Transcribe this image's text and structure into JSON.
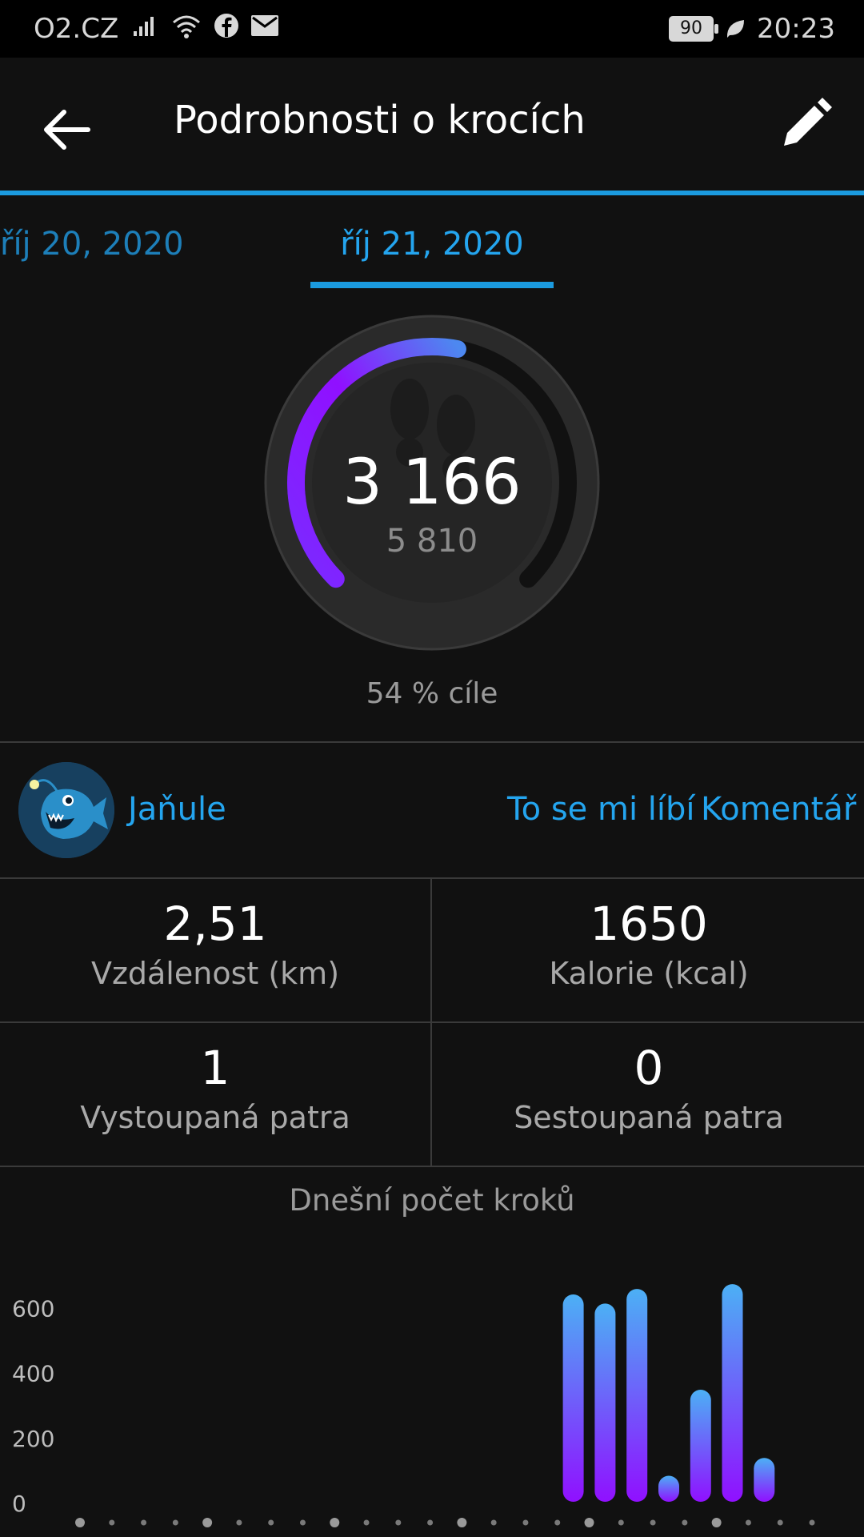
{
  "status_bar": {
    "carrier": "O2.CZ",
    "battery": "90",
    "time": "20:23"
  },
  "header": {
    "title": "Podrobnosti o krocích"
  },
  "date_tabs": {
    "previous": "říj 20, 2020",
    "current": "říj 21, 2020"
  },
  "summary": {
    "steps": "3 166",
    "goal": "5 810",
    "goal_percent_label": "54 % cíle",
    "progress_fraction": 0.54
  },
  "social": {
    "user_name": "Jaňule",
    "like_label": "To se mi líbí",
    "comment_label": "Komentář"
  },
  "stats": [
    {
      "value": "2,51",
      "label": "Vzdálenost (km)"
    },
    {
      "value": "1650",
      "label": "Kalorie (kcal)"
    },
    {
      "value": "1",
      "label": "Vystoupaná patra"
    },
    {
      "value": "0",
      "label": "Sestoupaná patra"
    }
  ],
  "chart_data": {
    "type": "bar",
    "title": "Dnešní počet kroků",
    "xlabel": "",
    "ylabel": "",
    "yticks": [
      "0",
      "200",
      "400",
      "600"
    ],
    "ylim": [
      0,
      680
    ],
    "slot_count": 24,
    "bars": [
      {
        "slot": 15,
        "value": 638
      },
      {
        "slot": 16,
        "value": 610
      },
      {
        "slot": 17,
        "value": 655
      },
      {
        "slot": 18,
        "value": 80
      },
      {
        "slot": 19,
        "value": 345
      },
      {
        "slot": 20,
        "value": 670
      },
      {
        "slot": 21,
        "value": 135
      }
    ],
    "colors": {
      "top": "#4cb0f5",
      "bottom": "#9010ff"
    }
  }
}
